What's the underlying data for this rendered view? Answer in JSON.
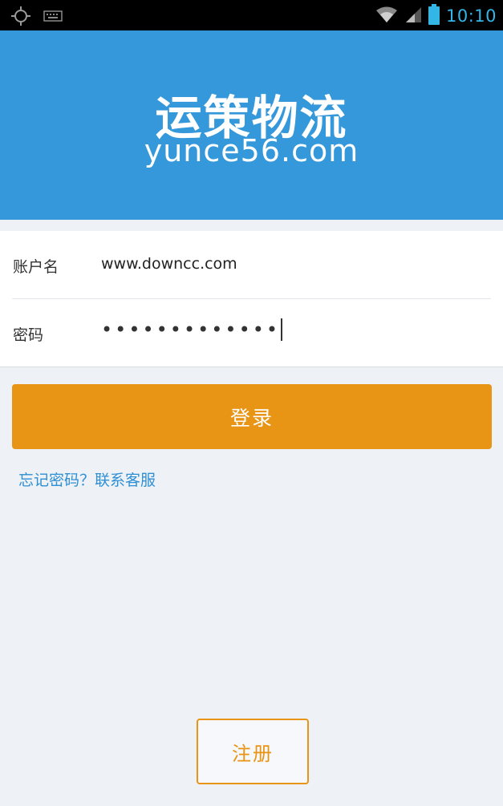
{
  "status_bar": {
    "time": "10:10",
    "icons": [
      "gps-icon",
      "keyboard-icon",
      "wifi-icon",
      "signal-icon",
      "battery-icon"
    ]
  },
  "header": {
    "logo_cn": "运策物流",
    "logo_en": "yunce56.com"
  },
  "form": {
    "account_label": "账户名",
    "account_value": "www.downcc.com",
    "password_label": "密码",
    "password_mask": "•••••••••••••"
  },
  "login_label": "登录",
  "forgot_link": "忘记密码？联系客服",
  "register_label": "注册",
  "colors": {
    "header_bg": "#3498db",
    "accent": "#e89414",
    "link": "#2f8fd3",
    "background": "#eef2f7"
  }
}
